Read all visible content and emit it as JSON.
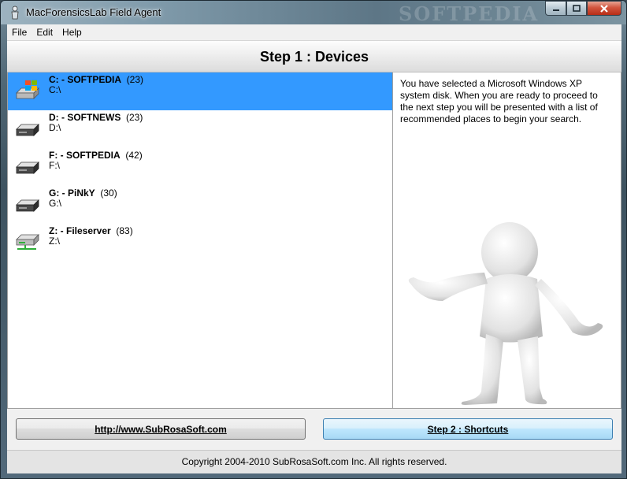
{
  "window": {
    "title": "MacForensicsLab Field Agent",
    "watermark": "SOFTPEDIA"
  },
  "menu": {
    "items": [
      {
        "label": "File"
      },
      {
        "label": "Edit"
      },
      {
        "label": "Help"
      }
    ]
  },
  "step_header": "Step 1 : Devices",
  "devices": [
    {
      "name": "C: - SOFTPEDIA",
      "count": "(23)",
      "path": "C:\\",
      "icon": "windows-drive-icon",
      "selected": true
    },
    {
      "name": "D: - SOFTNEWS",
      "count": "(23)",
      "path": "D:\\",
      "icon": "hard-drive-icon",
      "selected": false
    },
    {
      "name": "F: - SOFTPEDIA",
      "count": "(42)",
      "path": "F:\\",
      "icon": "hard-drive-icon",
      "selected": false
    },
    {
      "name": "G: - PiNkY",
      "count": "(30)",
      "path": "G:\\",
      "icon": "hard-drive-icon",
      "selected": false
    },
    {
      "name": "Z: - Fileserver",
      "count": "(83)",
      "path": "Z:\\",
      "icon": "network-drive-icon",
      "selected": false
    }
  ],
  "info": {
    "text": "You have selected a Microsoft Windows XP system disk. When you are ready to proceed to the next step you will be presented with a list of recommended places to begin your search."
  },
  "buttons": {
    "link": "http://www.SubRosaSoft.com",
    "next": "Step 2 : Shortcuts"
  },
  "footer": "Copyright 2004-2010 SubRosaSoft.com Inc. All rights reserved.",
  "colors": {
    "selection": "#3399ff",
    "window_chrome": "#4f6674"
  }
}
